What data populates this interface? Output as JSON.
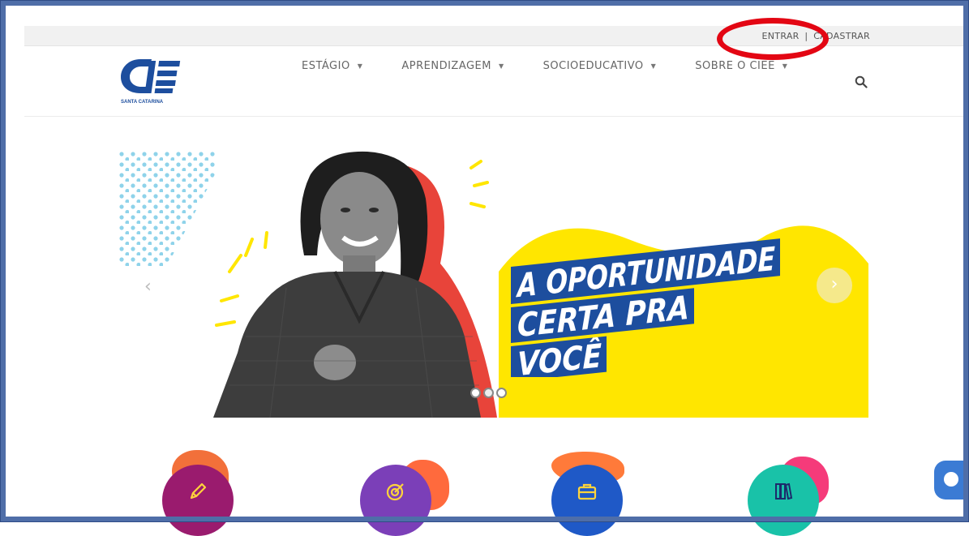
{
  "topbar": {
    "login_label": "ENTRAR",
    "separator": "|",
    "register_label": "CADASTRAR"
  },
  "logo": {
    "name": "CIEE",
    "subtitle": "SANTA CATARINA"
  },
  "nav": {
    "items": [
      {
        "label": "ESTÁGIO",
        "icon": "caret-down-icon"
      },
      {
        "label": "APRENDIZAGEM",
        "icon": "caret-down-icon"
      },
      {
        "label": "SOCIOEDUCATIVO",
        "icon": "caret-down-icon"
      },
      {
        "label": "SOBRE O CIEE",
        "icon": "caret-down-icon"
      }
    ],
    "search_icon": "search-icon"
  },
  "hero": {
    "headline_line1": "A OPORTUNIDADE",
    "headline_line2": "CERTA PRA",
    "headline_line3": "VOCÊ",
    "prev_icon": "chevron-left-icon",
    "next_icon": "chevron-right-icon",
    "slides_count": 3,
    "active_slide": 1
  },
  "categories": [
    {
      "icon": "pencil-icon",
      "color": "#9a1b6e",
      "blob_color": "#f2703a"
    },
    {
      "icon": "target-icon",
      "color": "#7b3fb8",
      "blob_color": "#ff6a3d"
    },
    {
      "icon": "briefcase-icon",
      "color": "#1f59c7",
      "blob_color": "#ff7a3a"
    },
    {
      "icon": "books-icon",
      "color": "#19c2a8",
      "blob_color": "#f53b7a"
    }
  ],
  "colors": {
    "accent_yellow": "#ffe600",
    "brand_blue": "#1d4e9e",
    "highlight_red": "#e30613"
  },
  "chat_icon": "chat-icon"
}
